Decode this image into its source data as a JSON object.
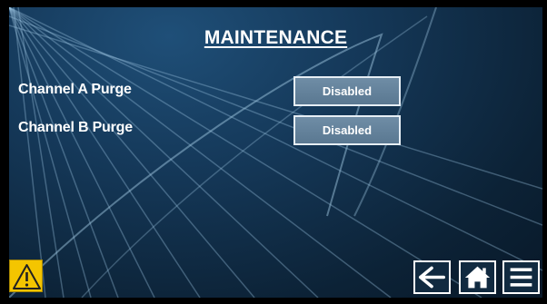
{
  "header": {
    "title": "MAINTENANCE"
  },
  "rows": [
    {
      "label": "Channel A Purge",
      "value": "Disabled"
    },
    {
      "label": "Channel B Purge",
      "value": "Disabled"
    }
  ],
  "footer": {
    "warning_icon": "warning-icon",
    "back_icon": "arrow-left-icon",
    "home_icon": "home-icon",
    "menu_icon": "menu-icon"
  },
  "colors": {
    "background": "#15395a",
    "button": "#6f8da6",
    "warning": "#f4c500"
  }
}
